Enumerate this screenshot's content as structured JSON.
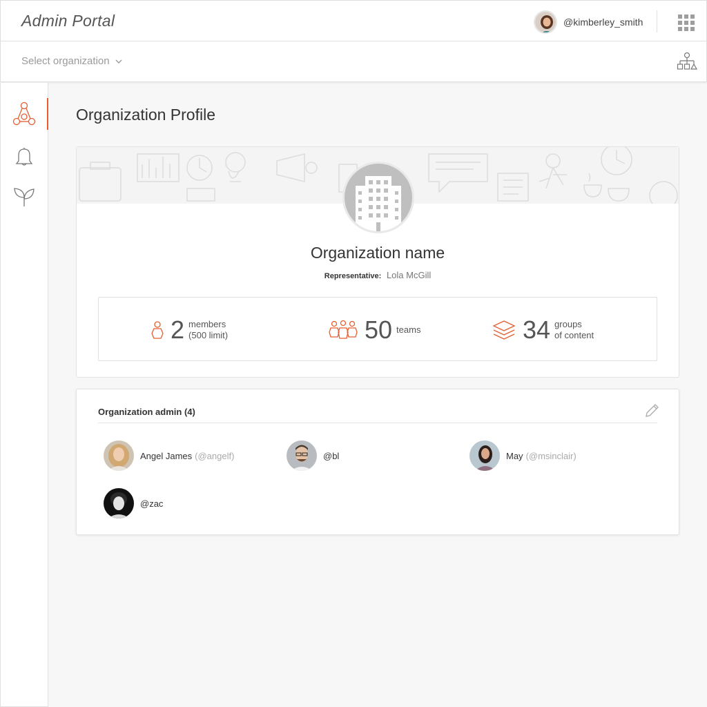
{
  "app": {
    "title": "Admin Portal",
    "accent": "#e65c2e"
  },
  "user": {
    "username": "@kimberley_smith"
  },
  "orgbar": {
    "select_placeholder": "Select organization"
  },
  "page": {
    "title": "Organization Profile"
  },
  "organization": {
    "name": "Organization name",
    "representative_label": "Representative:",
    "representative": "Lola McGill"
  },
  "stats": {
    "members": {
      "value": "2",
      "label_line1": "members",
      "label_line2": "(500 limit)"
    },
    "teams": {
      "value": "50",
      "label_line1": "teams"
    },
    "groups": {
      "value": "34",
      "label_line1": "groups",
      "label_line2": "of content"
    }
  },
  "admins": {
    "title": "Organization admin (4)",
    "members": [
      {
        "name": "Angel James",
        "handle": "(@angelf)"
      },
      {
        "name": "@bl",
        "handle": ""
      },
      {
        "name": "May",
        "handle": "(@msinclair)"
      },
      {
        "name": "@zac",
        "handle": ""
      }
    ]
  },
  "icons": {
    "sidebar": [
      "organization-icon",
      "bell-icon",
      "leaf-icon"
    ],
    "header": [
      "apps-grid-icon",
      "hierarchy-icon"
    ]
  }
}
